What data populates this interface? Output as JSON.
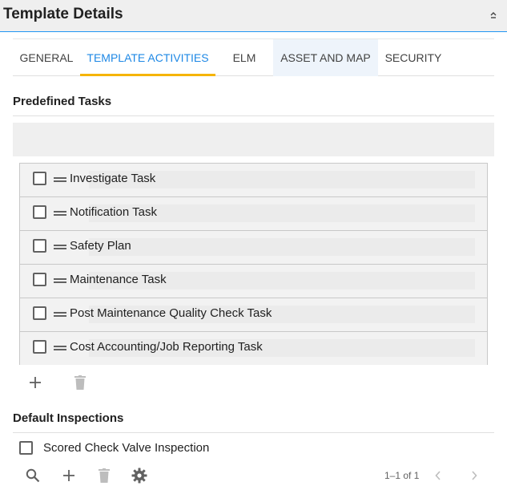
{
  "header": {
    "title": "Template Details"
  },
  "tabs": [
    {
      "label": "GENERAL"
    },
    {
      "label": "TEMPLATE ACTIVITIES"
    },
    {
      "label": "ELM"
    },
    {
      "label": "ASSET AND MAP"
    },
    {
      "label": "SECURITY"
    }
  ],
  "active_tab": "TEMPLATE ACTIVITIES",
  "predefined_tasks": {
    "title": "Predefined Tasks",
    "items": [
      {
        "label": "Investigate Task",
        "checked": false
      },
      {
        "label": "Notification Task",
        "checked": false
      },
      {
        "label": "Safety Plan",
        "checked": false
      },
      {
        "label": "Maintenance Task",
        "checked": false
      },
      {
        "label": "Post Maintenance Quality Check Task",
        "checked": false
      },
      {
        "label": "Cost Accounting/Job Reporting Task",
        "checked": false
      }
    ],
    "toolbar": {
      "add_icon": "plus-icon",
      "delete_icon": "trash-icon"
    }
  },
  "default_inspections": {
    "title": "Default Inspections",
    "items": [
      {
        "label": "Scored Check Valve Inspection",
        "checked": false
      }
    ],
    "toolbar": {
      "search_icon": "search-icon",
      "add_icon": "plus-icon",
      "delete_icon": "trash-icon",
      "settings_icon": "gear-icon"
    },
    "pagination": {
      "text": "1–1 of 1"
    }
  },
  "colors": {
    "accent": "#1e88e5",
    "tab_indicator": "#f5b400",
    "header_border": "#2196f3"
  }
}
